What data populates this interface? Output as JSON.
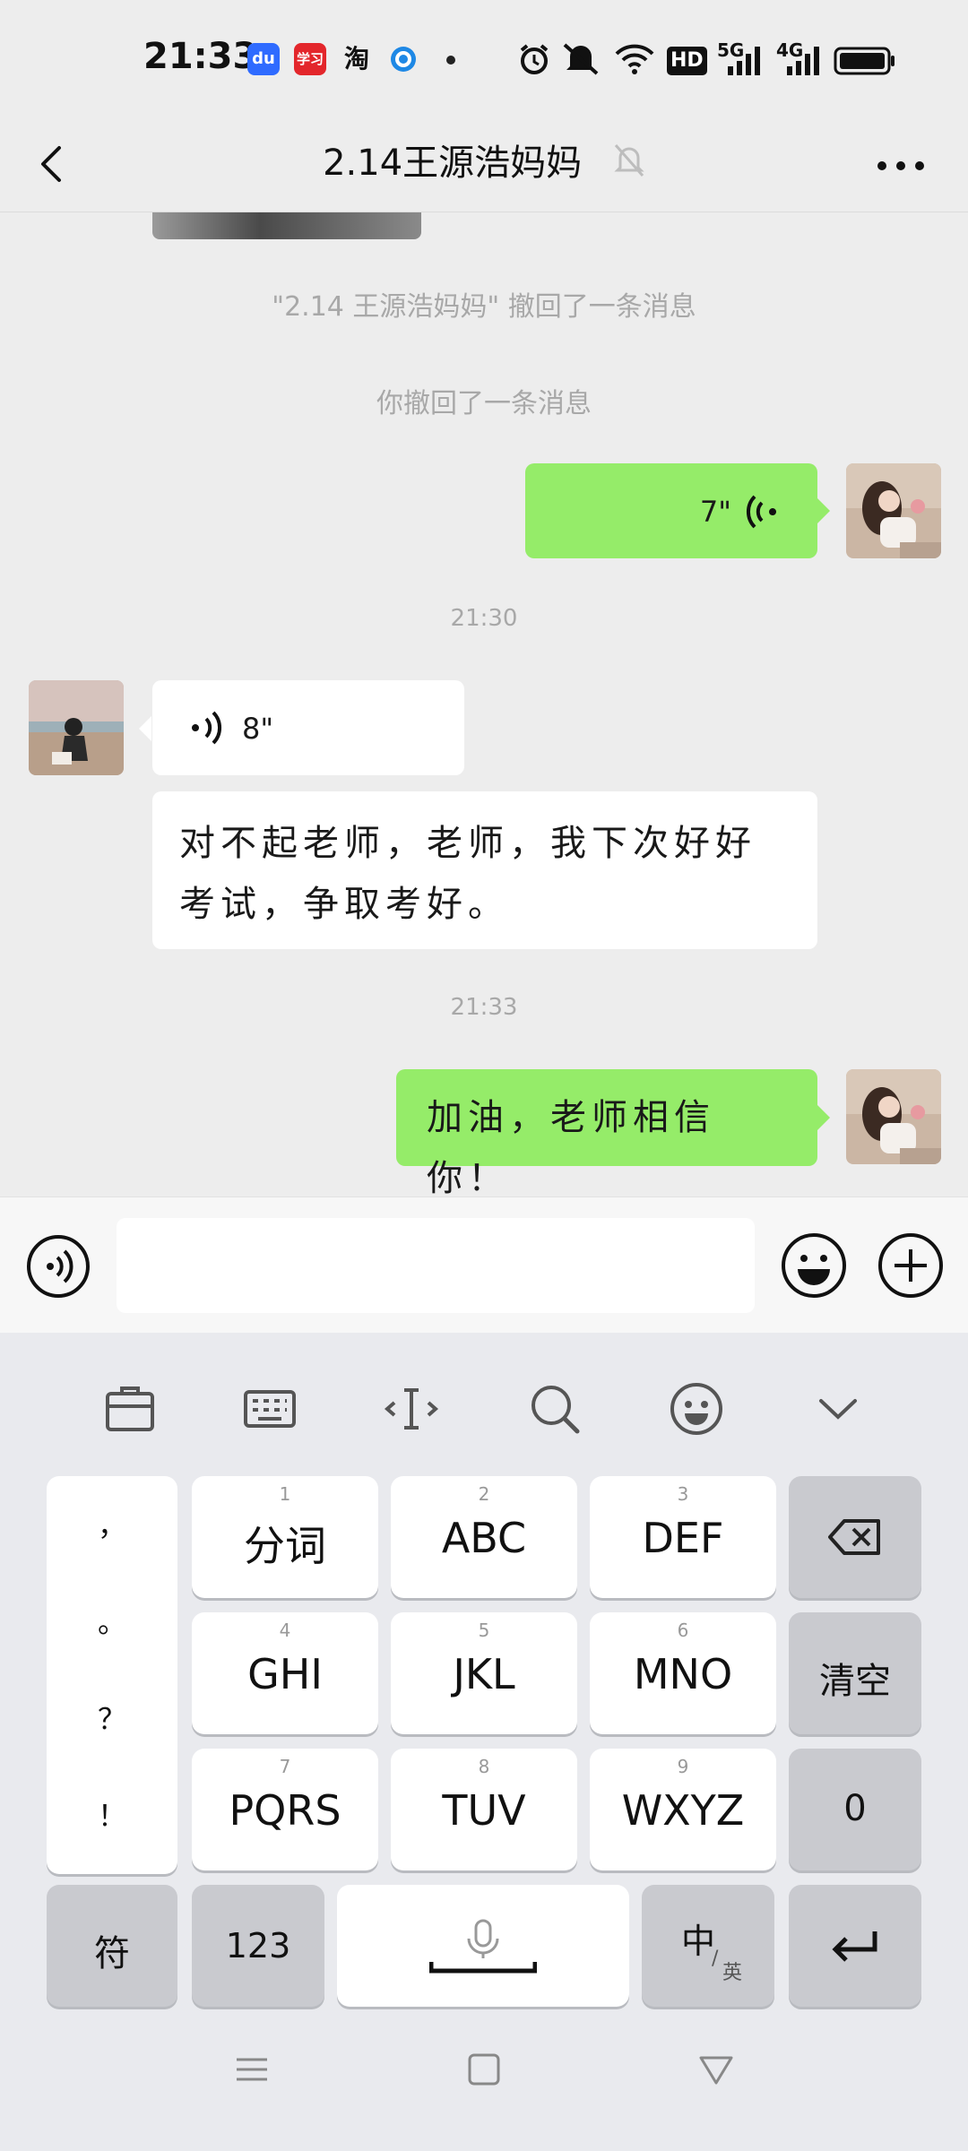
{
  "status_bar": {
    "time": "21:33",
    "app_icons": [
      "baidu-icon",
      "xuexi-icon",
      "taobao-icon",
      "browser-icon"
    ],
    "app_icon_labels": [
      "du",
      "学习",
      "淘"
    ],
    "hd_label": "HD",
    "net1": "5G",
    "net2": "4G"
  },
  "header": {
    "title": "2.14王源浩妈妈",
    "muted": true
  },
  "chat": {
    "system_recall_other": "\"2.14 王源浩妈妈\" 撤回了一条消息",
    "system_recall_self": "你撤回了一条消息",
    "voice_out_duration": "7\"",
    "timestamp1": "21:30",
    "voice_in_duration": "8\"",
    "text_in": "对不起老师，老师，我下次好好考试，争取考好。",
    "timestamp2": "21:33",
    "text_out": "加油，老师相信你！"
  },
  "input": {
    "placeholder": "",
    "value": ""
  },
  "keyboard": {
    "punct": [
      "，",
      "。",
      "？",
      "！"
    ],
    "rows": [
      [
        {
          "num": "1",
          "label": "分词"
        },
        {
          "num": "2",
          "label": "ABC"
        },
        {
          "num": "3",
          "label": "DEF"
        }
      ],
      [
        {
          "num": "4",
          "label": "GHI"
        },
        {
          "num": "5",
          "label": "JKL"
        },
        {
          "num": "6",
          "label": "MNO"
        }
      ],
      [
        {
          "num": "7",
          "label": "PQRS"
        },
        {
          "num": "8",
          "label": "TUV"
        },
        {
          "num": "9",
          "label": "WXYZ"
        }
      ]
    ],
    "clear_label": "清空",
    "zero_label": "0",
    "symbol_label": "符",
    "num_label": "123",
    "lang_main": "中",
    "lang_sub": "英"
  },
  "colors": {
    "outgoing_bubble": "#95ec69",
    "incoming_bubble": "#ffffff",
    "background": "#ededed"
  }
}
